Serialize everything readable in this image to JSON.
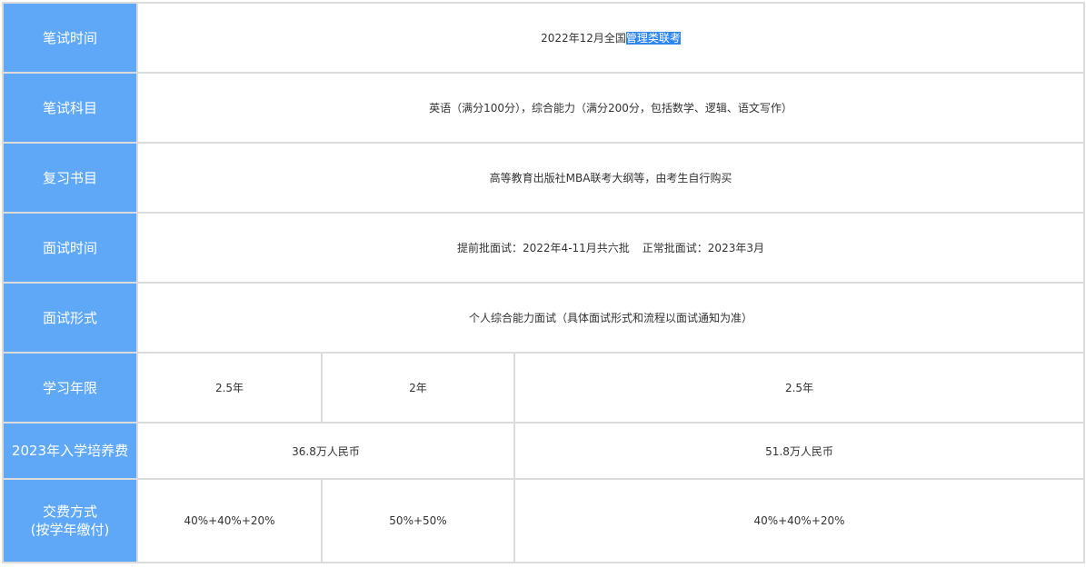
{
  "rows": {
    "written_time": {
      "label": "笔试时间",
      "value_prefix": "2022年12月全国",
      "value_highlight": "管理类联考"
    },
    "written_subjects": {
      "label": "笔试科目",
      "value": "英语（满分100分），综合能力（满分200分，包括数学、逻辑、语文写作）"
    },
    "review_books": {
      "label": "复习书目",
      "value": "高等教育出版社MBA联考大纲等，由考生自行购买"
    },
    "interview_time": {
      "label": "面试时间",
      "early": "提前批面试：2022年4-11月共六批",
      "regular": "正常批面试：2023年3月"
    },
    "interview_form": {
      "label": "面试形式",
      "value": "个人综合能力面试（具体面试形式和流程以面试通知为准）"
    },
    "study_years": {
      "label": "学习年限",
      "values": [
        "2.5年",
        "2年",
        "2.5年"
      ]
    },
    "tuition": {
      "label": "2023年入学培养费",
      "values": [
        "36.8万人民币",
        "51.8万人民币"
      ]
    },
    "payment": {
      "label_line1": "交费方式",
      "label_line2": "(按学年缴付)",
      "values": [
        "40%+40%+20%",
        "50%+50%",
        "40%+40%+20%"
      ]
    }
  }
}
